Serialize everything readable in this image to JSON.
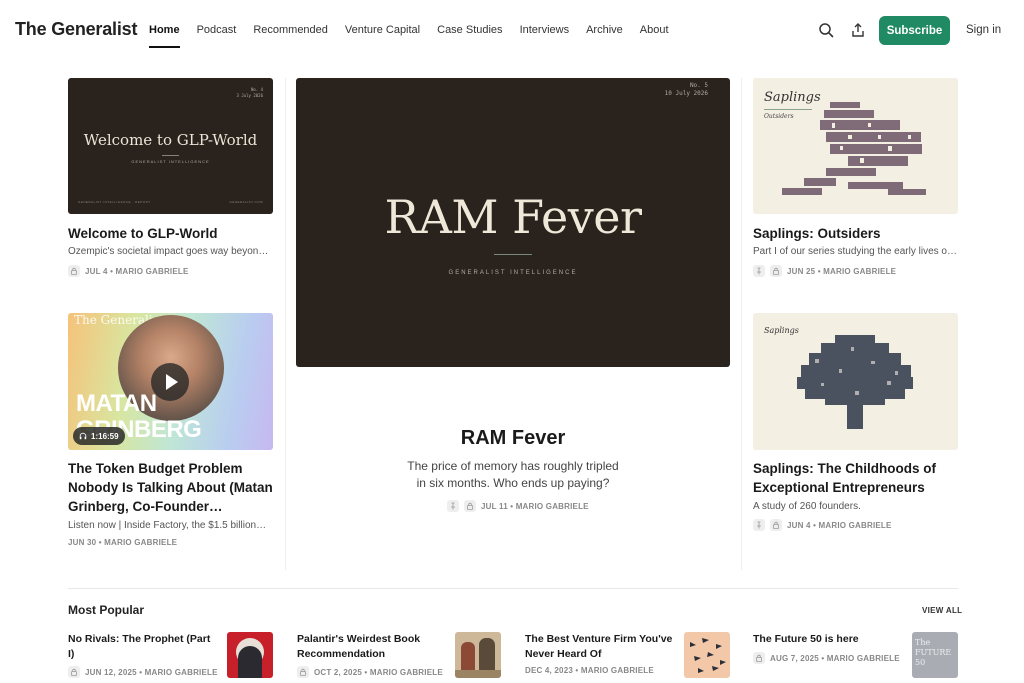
{
  "header": {
    "brand": "The Generalist",
    "nav": [
      "Home",
      "Podcast",
      "Recommended",
      "Venture Capital",
      "Case Studies",
      "Interviews",
      "Archive",
      "About"
    ],
    "subscribe_label": "Subscribe",
    "signin_label": "Sign in"
  },
  "left_top": {
    "thumb": {
      "number": "No. 4",
      "date": "3 July 2026",
      "heading": "Welcome to GLP-World",
      "tagline": "GENERALIST INTELLIGENCE",
      "footer_left": "GENERALIST INTELLIGENCE · REPORT",
      "footer_right": "GENERALIST.COM"
    },
    "title": "Welcome to GLP-World",
    "subtitle": "Ozempic's societal impact goes way beyond…",
    "meta": "JUL 4 • MARIO GABRIELE"
  },
  "left_bottom": {
    "thumb": {
      "brand": "The Generalist",
      "name_line1": "MATAN",
      "name_line2": "GRINBERG",
      "duration": "1:16:59"
    },
    "title": "The Token Budget Problem Nobody Is Talking About (Matan Grinberg, Co-Founder…",
    "subtitle": "Listen now | Inside Factory, the $1.5 billion…",
    "meta": "JUN 30 • MARIO GABRIELE"
  },
  "center": {
    "thumb": {
      "number": "No. 5",
      "date": "10 July 2026",
      "heading": "RAM Fever",
      "tagline": "GENERALIST INTELLIGENCE"
    },
    "title": "RAM Fever",
    "subtitle_line1": "The price of memory has roughly tripled",
    "subtitle_line2": "in six months. Who ends up paying?",
    "meta": "JUL 11 • MARIO GABRIELE"
  },
  "right_top": {
    "thumb": {
      "heading": "Saplings",
      "subheading": "Outsiders"
    },
    "title": "Saplings: Outsiders",
    "subtitle": "Part I of our series studying the early lives of…",
    "meta": "JUN 25 • MARIO GABRIELE"
  },
  "right_bottom": {
    "thumb": {
      "heading": "Saplings"
    },
    "title": "Saplings: The Childhoods of Exceptional Entrepreneurs",
    "subtitle": "A study of 260 founders.",
    "meta": "JUN 4 • MARIO GABRIELE"
  },
  "popular": {
    "title": "Most Popular",
    "view_all": "VIEW ALL",
    "items": [
      {
        "title": "No Rivals: The Prophet (Part I)",
        "meta": "JUN 12, 2025 • MARIO GABRIELE"
      },
      {
        "title": "Palantir's Weirdest Book Recommendation",
        "meta": "OCT 2, 2025 • MARIO GABRIELE"
      },
      {
        "title": "The Best Venture Firm You've Never Heard Of",
        "meta": "DEC 4, 2023 • MARIO GABRIELE"
      },
      {
        "title": "The Future 50 is here",
        "meta": "AUG 7, 2025 • MARIO GABRIELE",
        "thumb_text": "The FUTURE 50"
      }
    ]
  },
  "colors": {
    "accent": "#1f8a64",
    "dark_cover": "#2a221d",
    "cream_cover": "#f3efe3"
  }
}
